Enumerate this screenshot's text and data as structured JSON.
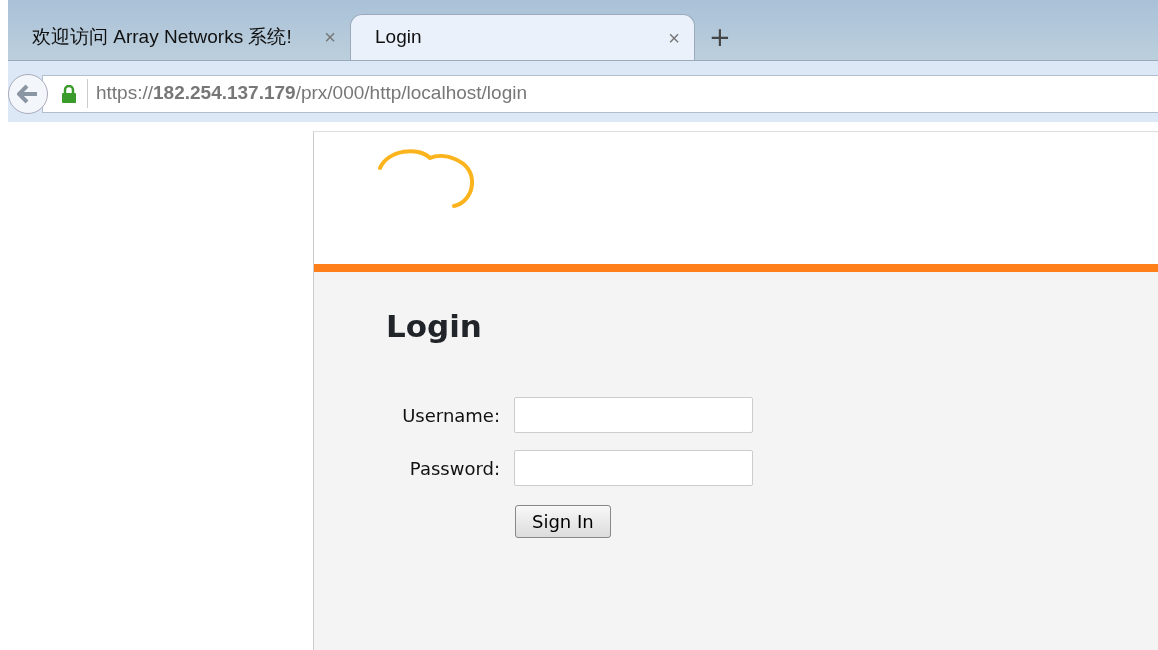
{
  "browser": {
    "tabs": [
      {
        "title": "欢迎访问 Array Networks 系统!",
        "close": "×",
        "selected": false
      },
      {
        "title": "Login",
        "close": "×",
        "selected": true
      }
    ],
    "new_tab": "+",
    "address": "https://**182.254.137.179**/prx/000/http/localhost/login",
    "secure": true
  },
  "page": {
    "heading": "Login",
    "fields": [
      {
        "label": "Username:"
      },
      {
        "label": "Password:"
      }
    ],
    "submit": "Sign In"
  }
}
